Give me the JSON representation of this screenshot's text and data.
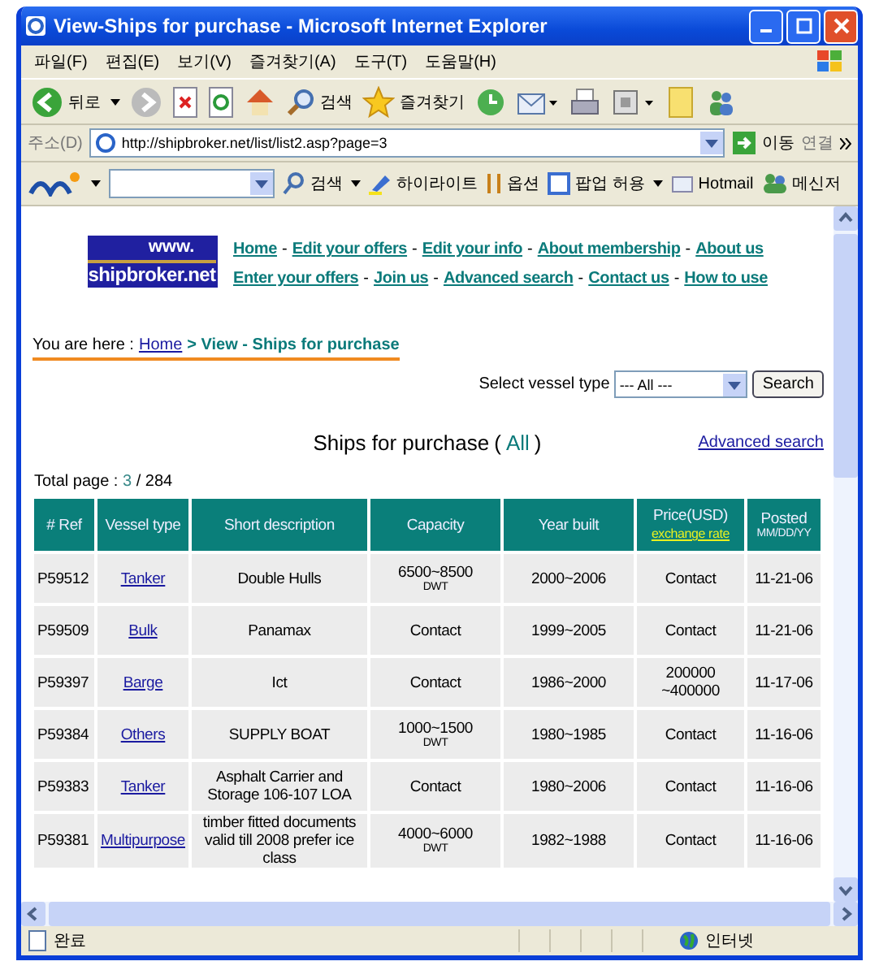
{
  "window": {
    "title": "View-Ships for purchase - Microsoft Internet Explorer"
  },
  "menu": [
    "파일(F)",
    "편집(E)",
    "보기(V)",
    "즐겨찾기(A)",
    "도구(T)",
    "도움말(H)"
  ],
  "toolbar": {
    "back": "뒤로",
    "search": "검색",
    "favorites": "즐겨찾기"
  },
  "address": {
    "label": "주소(D)",
    "url": "http://shipbroker.net/list/list2.asp?page=3",
    "go": "이동",
    "links": "연결"
  },
  "msn_bar": {
    "search": "검색",
    "highlight": "하이라이트",
    "options": "옵션",
    "popup": "팝업 허용",
    "hotmail": "Hotmail",
    "messenger": "메신저"
  },
  "logo": {
    "line1": "www.",
    "line2": "shipbroker.net"
  },
  "nav": {
    "separator": "-",
    "rows": [
      [
        "Home",
        "Edit your offers",
        "Edit your info",
        "About membership",
        "About us"
      ],
      [
        "Enter your offers",
        "Join us",
        "Advanced search",
        "Contact us",
        "How to use"
      ]
    ]
  },
  "breadcrumb": {
    "prefix": "You are here :",
    "home": "Home",
    "current": "> View - Ships for purchase"
  },
  "filter": {
    "label": "Select vessel type",
    "value": "--- All ---",
    "button": "Search"
  },
  "heading": {
    "title": "Ships for purchase",
    "open": "(",
    "filter": "All",
    "close": ")",
    "advanced": "Advanced search"
  },
  "pages": {
    "label": "Total page :",
    "current": "3",
    "total": "/ 284"
  },
  "table": {
    "columns": [
      {
        "label": "# Ref"
      },
      {
        "label": "Vessel type"
      },
      {
        "label": "Short description"
      },
      {
        "label": "Capacity"
      },
      {
        "label": "Year built"
      },
      {
        "label": "Price(USD)",
        "link": "exchange rate"
      },
      {
        "label": "Posted",
        "sub": "MM/DD/YY"
      }
    ],
    "rows": [
      {
        "ref": "P59512",
        "type": "Tanker",
        "description": "Double Hulls",
        "capacity": "6500~8500",
        "unit": "DWT",
        "year": "2000~2006",
        "price": "Contact",
        "posted": "11-21-06"
      },
      {
        "ref": "P59509",
        "type": "Bulk",
        "description": "Panamax",
        "capacity": "Contact",
        "year": "1999~2005",
        "price": "Contact",
        "posted": "11-21-06"
      },
      {
        "ref": "P59397",
        "type": "Barge",
        "description": "Ict",
        "capacity": "Contact",
        "year": "1986~2000",
        "price": "200000 ~400000",
        "posted": "11-17-06"
      },
      {
        "ref": "P59384",
        "type": "Others",
        "description": "SUPPLY BOAT",
        "capacity": "1000~1500",
        "unit": "DWT",
        "year": "1980~1985",
        "price": "Contact",
        "posted": "11-16-06"
      },
      {
        "ref": "P59383",
        "type": "Tanker",
        "description": "Asphalt Carrier and Storage 106-107 LOA",
        "capacity": "Contact",
        "year": "1980~2006",
        "price": "Contact",
        "posted": "11-16-06"
      },
      {
        "ref": "P59381",
        "type": "Multipurpose",
        "description": "timber fitted documents valid till 2008 prefer ice class",
        "capacity": "4000~6000",
        "unit": "DWT",
        "year": "1982~1988",
        "price": "Contact",
        "posted": "11-16-06"
      }
    ]
  },
  "status_bar": {
    "text": "완료",
    "zone": "인터넷"
  }
}
